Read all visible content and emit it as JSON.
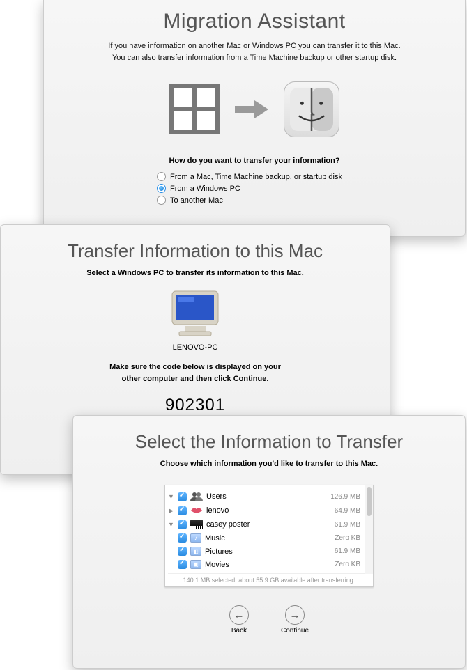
{
  "panel1": {
    "title": "Migration Assistant",
    "sub_line1": "If you have information on another Mac or Windows PC you can transfer it to this Mac.",
    "sub_line2": "You can also transfer information from a Time Machine backup or other startup disk.",
    "prompt": "How do you want to transfer your information?",
    "options": [
      {
        "label": "From a Mac, Time Machine backup, or startup disk",
        "selected": false
      },
      {
        "label": "From a Windows PC",
        "selected": true
      },
      {
        "label": "To another Mac",
        "selected": false
      }
    ]
  },
  "panel2": {
    "title": "Transfer Information to this Mac",
    "sub": "Select a Windows PC to transfer its information to this Mac.",
    "pc_name": "LENOVO-PC",
    "note_line1": "Make sure the code below is displayed on your",
    "note_line2": "other computer and then click Continue.",
    "code": "902301"
  },
  "panel3": {
    "title": "Select the Information to Transfer",
    "sub": "Choose which information you'd like to transfer to this Mac.",
    "rows": [
      {
        "indent": 0,
        "disclosure": "▼",
        "icon": "users",
        "label": "Users",
        "size": "126.9 MB"
      },
      {
        "indent": 1,
        "disclosure": "▶",
        "icon": "lips",
        "label": "lenovo",
        "size": "64.9 MB"
      },
      {
        "indent": 1,
        "disclosure": "▼",
        "icon": "piano",
        "label": "casey poster",
        "size": "61.9 MB"
      },
      {
        "indent": 2,
        "disclosure": "",
        "icon": "music",
        "label": "Music",
        "size": "Zero KB"
      },
      {
        "indent": 2,
        "disclosure": "",
        "icon": "pics",
        "label": "Pictures",
        "size": "61.9 MB"
      },
      {
        "indent": 2,
        "disclosure": "",
        "icon": "movies",
        "label": "Movies",
        "size": "Zero KB"
      }
    ],
    "summary": "140.1 MB selected, about 55.9 GB available after transferring.",
    "back_label": "Back",
    "continue_label": "Continue"
  }
}
